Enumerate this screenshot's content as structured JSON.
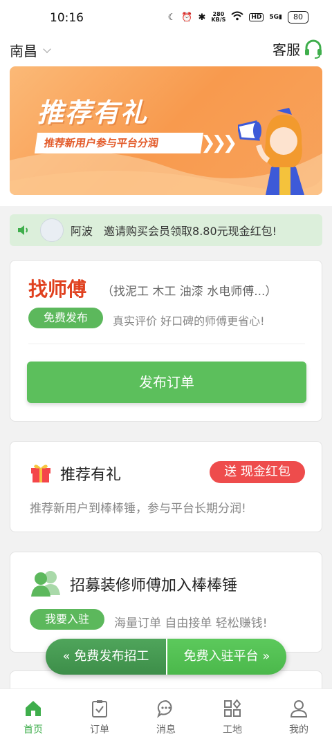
{
  "status_bar": {
    "time": "10:16",
    "net_speed_value": "280",
    "net_speed_unit": "KB/S",
    "hd": "HD",
    "signal": "5G",
    "battery": "80"
  },
  "header": {
    "city": "南昌",
    "service_label": "客服"
  },
  "banner": {
    "title": "推荐有礼",
    "subtitle": "推荐新用户参与平台分润",
    "arrows": "❯❯❯"
  },
  "notice": {
    "user": "阿波",
    "message": "邀请购买会员领取8.80元现金红包!"
  },
  "find_master": {
    "title": "找师傅",
    "subtitle": "（找泥工 木工 油漆 水电师傅...）",
    "tag": "免费发布",
    "desc": "真实评价 好口碑的师傅更省心!",
    "button": "发布订单"
  },
  "referral": {
    "title": "推荐有礼",
    "badge": "送 现金红包",
    "desc": "推荐新用户到棒棒锤，参与平台长期分润!"
  },
  "recruit": {
    "title": "招募装修师傅加入棒棒锤",
    "tag": "我要入驻",
    "desc": "海量订单 自由接单 轻松赚钱!"
  },
  "floating": {
    "left": "« 免费发布招工",
    "right": "免费入驻平台 »"
  },
  "tabs": [
    {
      "label": "首页",
      "icon": "home-icon",
      "active": true
    },
    {
      "label": "订单",
      "icon": "order-icon",
      "active": false
    },
    {
      "label": "消息",
      "icon": "message-icon",
      "active": false
    },
    {
      "label": "工地",
      "icon": "site-icon",
      "active": false
    },
    {
      "label": "我的",
      "icon": "profile-icon",
      "active": false
    }
  ],
  "colors": {
    "accent_green": "#3fae4c",
    "button_green": "#5cbf5c",
    "red": "#e0411f",
    "banner_orange": "#f89a4e"
  }
}
